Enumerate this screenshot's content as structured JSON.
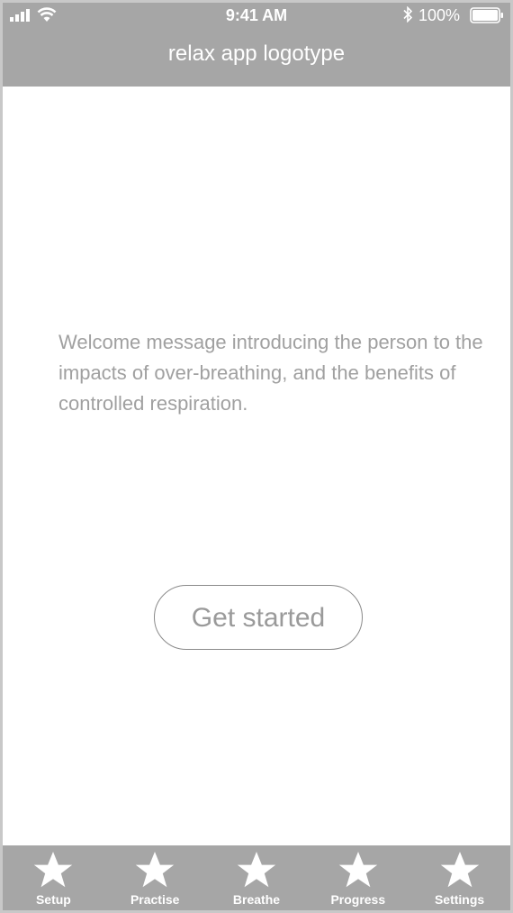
{
  "status_bar": {
    "time": "9:41 AM",
    "battery_percent": "100%",
    "signal_icon": "cellular-signal-icon",
    "wifi_icon": "wifi-icon",
    "bluetooth_icon": "bluetooth-icon",
    "battery_icon": "battery-icon"
  },
  "header": {
    "logotype": "relax app logotype"
  },
  "main": {
    "welcome_message": "Welcome message introducing the person to the impacts of over-breathing, and the benefits of controlled respiration.",
    "cta_label": "Get started"
  },
  "tab_bar": {
    "items": [
      {
        "label": "Setup",
        "icon": "star-icon"
      },
      {
        "label": "Practise",
        "icon": "star-icon"
      },
      {
        "label": "Breathe",
        "icon": "star-icon"
      },
      {
        "label": "Progress",
        "icon": "star-icon"
      },
      {
        "label": "Settings",
        "icon": "star-icon"
      }
    ]
  },
  "colors": {
    "chrome_background": "#a6a6a6",
    "chrome_text": "#ffffff",
    "body_text": "#a0a0a0",
    "button_border": "#8a8a8a"
  }
}
